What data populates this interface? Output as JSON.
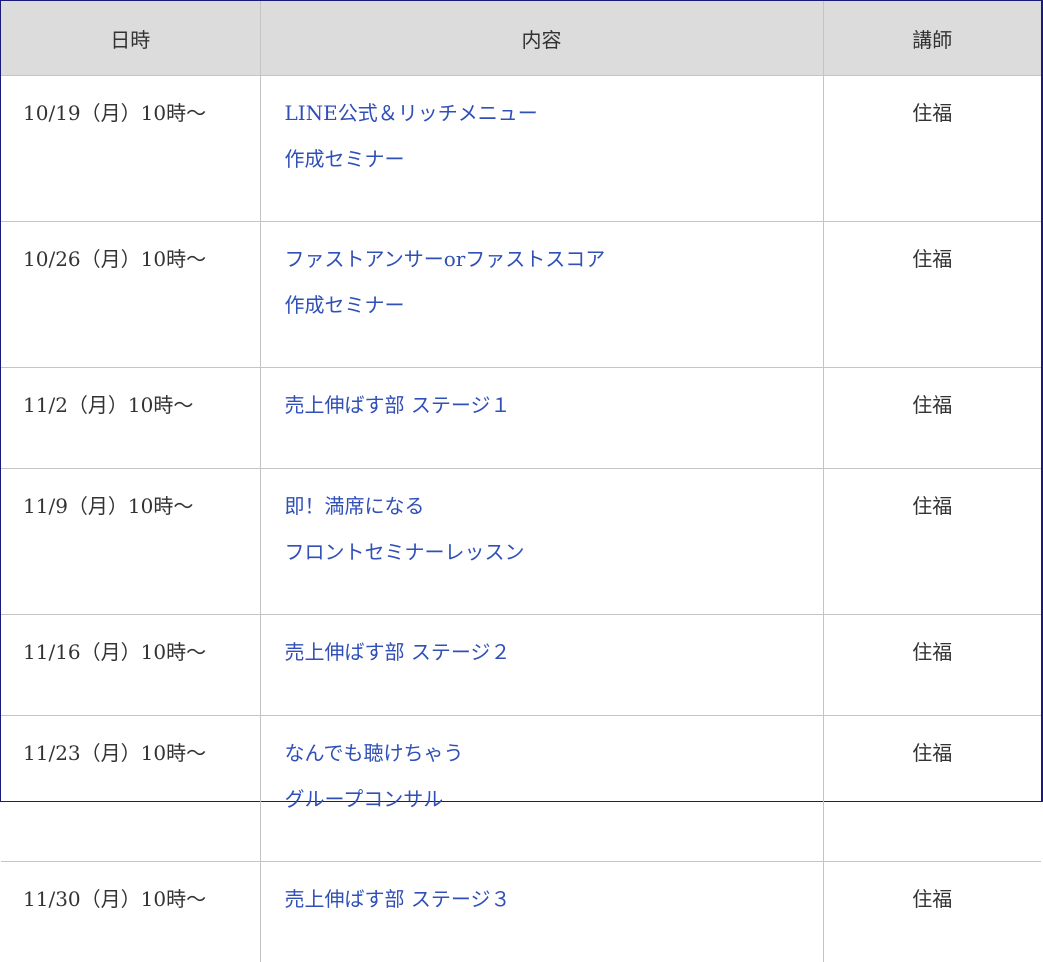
{
  "header": {
    "datetime": "日時",
    "content": "内容",
    "teacher": "講師"
  },
  "rows": [
    {
      "datetime": "10/19（月）10時〜",
      "content_lines": [
        "LINE公式＆リッチメニュー",
        "作成セミナー"
      ],
      "teacher": "住福"
    },
    {
      "datetime": "10/26（月）10時〜",
      "content_lines": [
        "ファストアンサーorファストスコア",
        "作成セミナー"
      ],
      "teacher": "住福"
    },
    {
      "datetime": "11/2（月）10時〜",
      "content_lines": [
        "売上伸ばす部 ステージ１"
      ],
      "teacher": "住福"
    },
    {
      "datetime": "11/9（月）10時〜",
      "content_lines": [
        "即！満席になる",
        "フロントセミナーレッスン"
      ],
      "teacher": "住福"
    },
    {
      "datetime": "11/16（月）10時〜",
      "content_lines": [
        "売上伸ばす部 ステージ２"
      ],
      "teacher": "住福"
    },
    {
      "datetime": "11/23（月）10時〜",
      "content_lines": [
        "なんでも聴けちゃう",
        "グループコンサル"
      ],
      "teacher": "住福"
    },
    {
      "datetime": "11/30（月）10時〜",
      "content_lines": [
        "売上伸ばす部 ステージ３"
      ],
      "teacher": "住福"
    }
  ],
  "colors": {
    "header_bg": "#dcdcdc",
    "link": "#3050b8",
    "text": "#333333",
    "grid": "#c4c4c4",
    "frame": "#1a1a7a"
  }
}
